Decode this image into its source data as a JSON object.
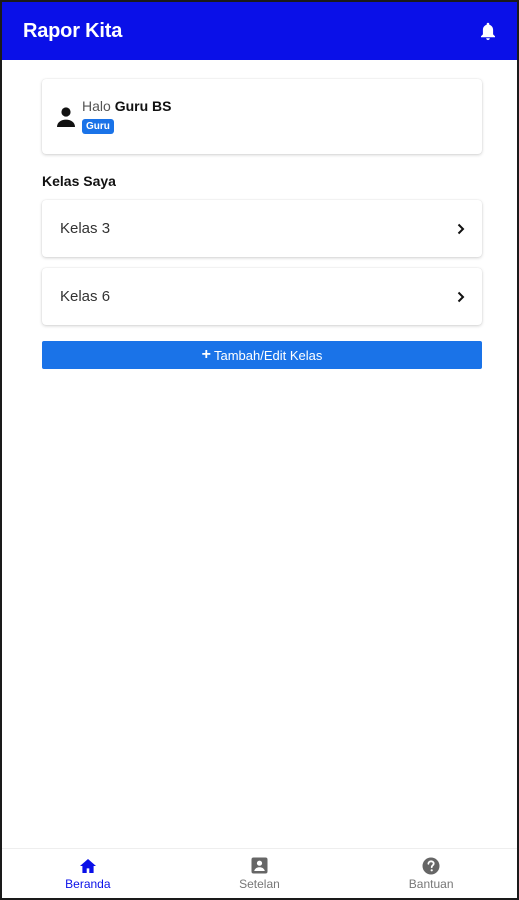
{
  "appbar": {
    "title": "Rapor Kita",
    "notification_icon": "bell-icon",
    "background_color": "#0a10e8"
  },
  "user_card": {
    "greeting": "Halo",
    "name": "Guru BS",
    "role_badge": "Guru",
    "icon": "person-icon"
  },
  "classes_section": {
    "title": "Kelas Saya",
    "items": [
      {
        "label": "Kelas 3",
        "icon": "chevron-right-icon"
      },
      {
        "label": "Kelas 6",
        "icon": "chevron-right-icon"
      }
    ]
  },
  "add_button": {
    "label": "Tambah/Edit Kelas",
    "icon": "plus-icon",
    "color": "#1a73e8"
  },
  "bottom_nav": {
    "items": [
      {
        "label": "Beranda",
        "icon": "home-icon",
        "active": true
      },
      {
        "label": "Setelan",
        "icon": "account-box-icon",
        "active": false
      },
      {
        "label": "Bantuan",
        "icon": "help-circle-icon",
        "active": false
      }
    ]
  }
}
